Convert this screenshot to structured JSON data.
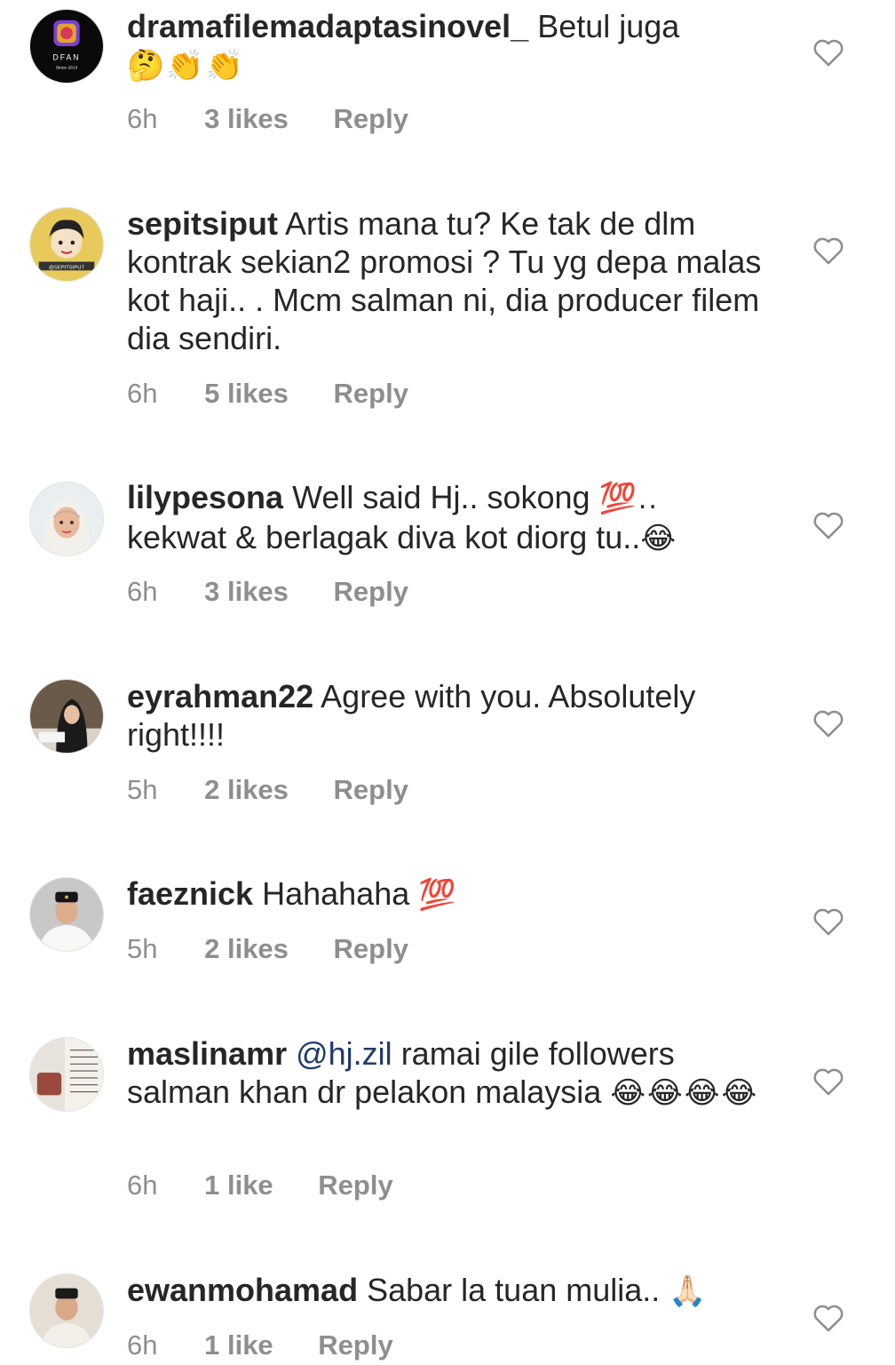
{
  "comments": [
    {
      "username": "dramafilemadaptasinovel_",
      "text_before": "Betul juga",
      "mention": "",
      "text_after": "",
      "emoji": "🤔👏👏",
      "time": "6h",
      "likes": "3 likes",
      "reply": "Reply",
      "avatar": "dfan-logo",
      "avatar_text": "DFAN",
      "avatar_subtext": "Since 2013"
    },
    {
      "username": "sepitsiput",
      "text_before": "Artis mana tu? Ke tak de dlm kontrak sekian2 promosi ? Tu yg depa malas kot haji.. . Mcm salman ni, dia producer filem dia sendiri.",
      "mention": "",
      "text_after": "",
      "emoji": "",
      "time": "6h",
      "likes": "5 likes",
      "reply": "Reply",
      "avatar": "cartoon-portrait",
      "avatar_text": "@SEPITSIPUT",
      "avatar_subtext": ""
    },
    {
      "username": "lilypesona",
      "text_before": "Well said Hj.. sokong",
      "mention": "",
      "text_after": "",
      "emoji": "💯..",
      "text_tail": "kekwat & berlagak diva kot diorg tu..",
      "emoji_tail": "😂",
      "time": "6h",
      "likes": "3 likes",
      "reply": "Reply",
      "avatar": "hijab-portrait"
    },
    {
      "username": "eyrahman22",
      "text_before": "Agree with you. Absolutely right!!!!",
      "mention": "",
      "text_after": "",
      "emoji": "",
      "time": "5h",
      "likes": "2 likes",
      "reply": "Reply",
      "avatar": "desk-photo"
    },
    {
      "username": "faeznick",
      "text_before": "Hahahaha",
      "mention": "",
      "text_after": "",
      "emoji": "💯",
      "time": "5h",
      "likes": "2 likes",
      "reply": "Reply",
      "avatar": "man-songkok"
    },
    {
      "username": "maslinamr",
      "text_before": "",
      "mention": "@hj.zil",
      "text_after": "ramai gile followers salman khan dr pelakon malaysia",
      "emoji": "😂😂😂😂",
      "time": "6h",
      "likes": "1 like",
      "reply": "Reply",
      "avatar": "book-photo"
    },
    {
      "username": "ewanmohamad",
      "text_before": "Sabar la tuan mulia..",
      "mention": "",
      "text_after": "",
      "emoji": "🙏🏻",
      "time": "6h",
      "likes": "1 like",
      "reply": "Reply",
      "avatar": "man-portrait"
    }
  ],
  "colors": {
    "text": "#262626",
    "meta": "#8e8e8e",
    "mention": "#1f3a6b",
    "heart_stroke": "#8e8e8e"
  },
  "icons": {
    "like": "heart-outline-icon"
  }
}
